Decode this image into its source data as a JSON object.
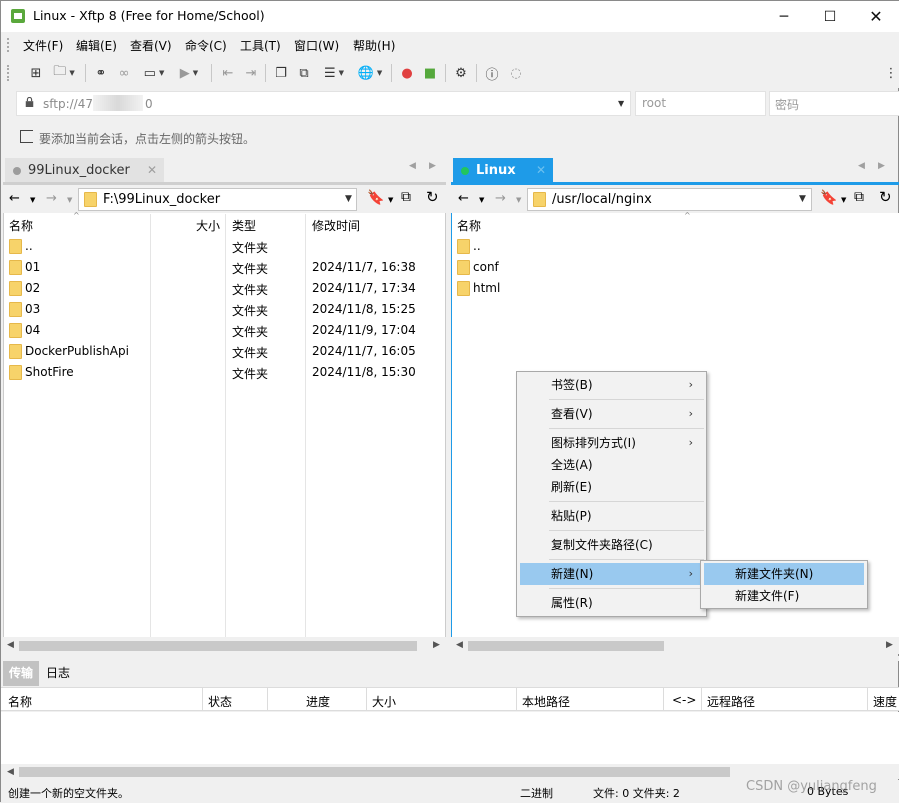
{
  "window": {
    "title": "Linux - Xftp 8 (Free for Home/School)"
  },
  "menu": [
    "文件(F)",
    "编辑(E)",
    "查看(V)",
    "命令(C)",
    "工具(T)",
    "窗口(W)",
    "帮助(H)"
  ],
  "address": {
    "value": "sftp://47",
    "value_suffix": "0",
    "user_placeholder": "root",
    "password_placeholder": "密码"
  },
  "hint": "要添加当前会话，点击左侧的箭头按钮。",
  "left": {
    "tab": "99Linux_docker",
    "path": "F:\\99Linux_docker",
    "columns": {
      "name": "名称",
      "size": "大小",
      "type": "类型",
      "mtime": "修改时间"
    },
    "rows": [
      {
        "name": "..",
        "type": "文件夹",
        "mtime": ""
      },
      {
        "name": "01",
        "type": "文件夹",
        "mtime": "2024/11/7, 16:38"
      },
      {
        "name": "02",
        "type": "文件夹",
        "mtime": "2024/11/7, 17:34"
      },
      {
        "name": "03",
        "type": "文件夹",
        "mtime": "2024/11/8, 15:25"
      },
      {
        "name": "04",
        "type": "文件夹",
        "mtime": "2024/11/9, 17:04"
      },
      {
        "name": "DockerPublishApi",
        "type": "文件夹",
        "mtime": "2024/11/7, 16:05"
      },
      {
        "name": "ShotFire",
        "type": "文件夹",
        "mtime": "2024/11/8, 15:30"
      }
    ]
  },
  "right": {
    "tab": "Linux",
    "path": "/usr/local/nginx",
    "columns": {
      "name": "名称"
    },
    "rows": [
      {
        "name": ".."
      },
      {
        "name": "conf"
      },
      {
        "name": "html"
      }
    ]
  },
  "context_menu": {
    "items": [
      "书签(B)",
      "查看(V)",
      "图标排列方式(I)",
      "全选(A)",
      "刷新(E)",
      "粘贴(P)",
      "复制文件夹路径(C)",
      "新建(N)",
      "属性(R)"
    ],
    "submenu": [
      "新建文件夹(N)",
      "新建文件(F)"
    ]
  },
  "transfer": {
    "tabs": [
      "传输",
      "日志"
    ],
    "columns": [
      "名称",
      "状态",
      "进度",
      "大小",
      "本地路径",
      "<->",
      "远程路径",
      "速度"
    ]
  },
  "status": {
    "message": "创建一个新的空文件夹。",
    "mode": "二进制",
    "counts": "文件: 0  文件夹: 2",
    "bytes": "0 Bytes",
    "watermark": "CSDN @yuliangfeng"
  },
  "colors": {
    "accent": "#1e9be8",
    "selection": "#99c9ef",
    "folder": "#f7d36a",
    "connected": "#22c55e"
  }
}
